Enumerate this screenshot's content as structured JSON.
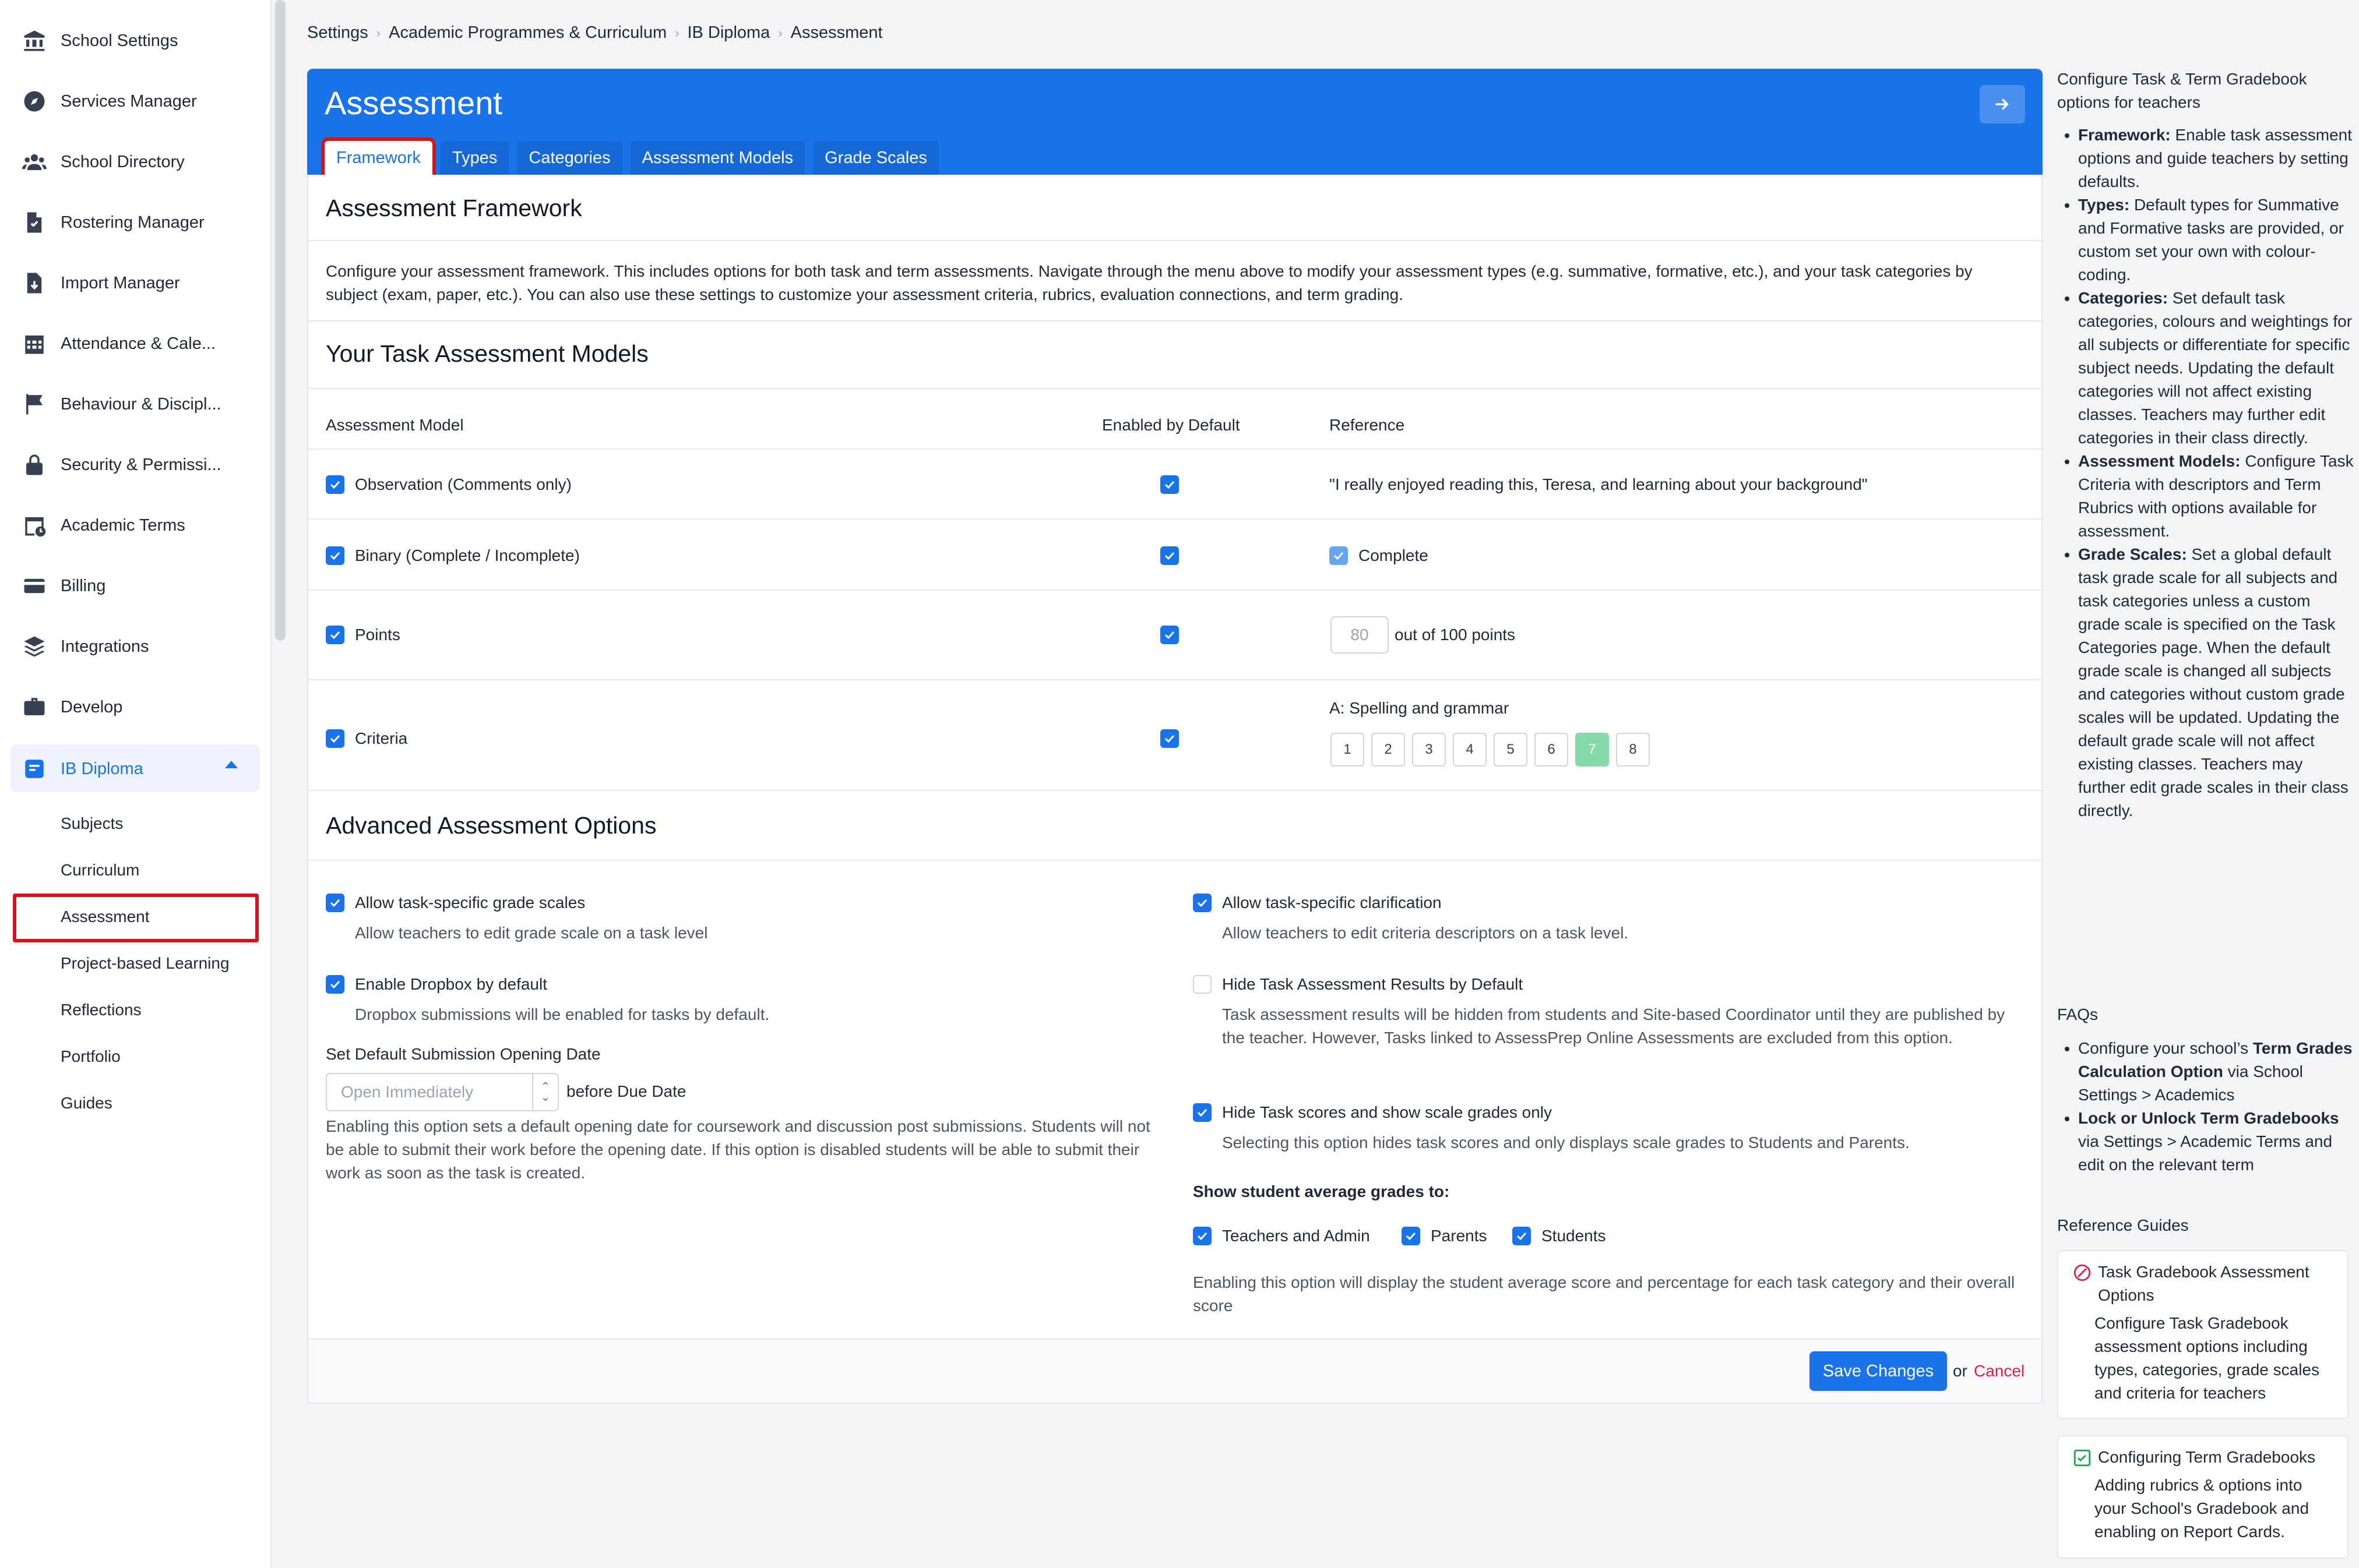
{
  "sidebar": {
    "items": [
      {
        "label": "School Settings",
        "icon": "bank-icon"
      },
      {
        "label": "Services Manager",
        "icon": "compass-icon"
      },
      {
        "label": "School Directory",
        "icon": "people-icon"
      },
      {
        "label": "Rostering Manager",
        "icon": "file-icon"
      },
      {
        "label": "Import Manager",
        "icon": "file-import-icon"
      },
      {
        "label": "Attendance & Cale...",
        "icon": "calendar-icon"
      },
      {
        "label": "Behaviour & Discipl...",
        "icon": "flag-icon"
      },
      {
        "label": "Security & Permissi...",
        "icon": "lock-icon"
      },
      {
        "label": "Academic Terms",
        "icon": "calendar-clock-icon"
      },
      {
        "label": "Billing",
        "icon": "card-icon"
      },
      {
        "label": "Integrations",
        "icon": "layers-icon"
      },
      {
        "label": "Develop",
        "icon": "briefcase-icon"
      },
      {
        "label": "IB Diploma",
        "icon": "ib-icon"
      }
    ],
    "subitems": [
      "Subjects",
      "Curriculum",
      "Assessment",
      "Project-based Learning",
      "Reflections",
      "Portfolio",
      "Guides"
    ]
  },
  "breadcrumb": [
    "Settings",
    "Academic Programmes & Curriculum",
    "IB Diploma",
    "Assessment"
  ],
  "header": {
    "title": "Assessment",
    "tabs": [
      "Framework",
      "Types",
      "Categories",
      "Assessment Models",
      "Grade Scales"
    ]
  },
  "framework": {
    "title": "Assessment Framework",
    "description": "Configure your assessment framework. This includes options for both task and term assessments. Navigate through the menu above to modify your assessment types (e.g. summative, formative, etc.), and your task categories by subject (exam, paper, etc.). You can also use these settings to customize your assessment criteria, rubrics, evaluation connections, and term grading."
  },
  "models": {
    "title": "Your Task Assessment Models",
    "col_model": "Assessment Model",
    "col_enabled": "Enabled by Default",
    "col_reference": "Reference",
    "rows": [
      {
        "name": "Observation (Comments only)",
        "reference": "\"I really enjoyed reading this, Teresa, and learning about your background\""
      },
      {
        "name": "Binary (Complete / Incomplete)",
        "reference": "Complete"
      },
      {
        "name": "Points",
        "points_value": "80",
        "reference": "out of 100 points"
      },
      {
        "name": "Criteria",
        "reference": "A: Spelling and grammar",
        "grades": [
          "1",
          "2",
          "3",
          "4",
          "5",
          "6",
          "7",
          "8"
        ],
        "selected_grade": "7"
      }
    ]
  },
  "advanced": {
    "title": "Advanced Assessment Options",
    "grade_scales": {
      "label": "Allow task-specific grade scales",
      "desc": "Allow teachers to edit grade scale on a task level"
    },
    "dropbox": {
      "label": "Enable Dropbox by default",
      "desc": "Dropbox submissions will be enabled for tasks by default."
    },
    "submission": {
      "label": "Set Default Submission Opening Date",
      "placeholder": "Open Immediately",
      "suffix": "before Due Date",
      "desc": "Enabling this option sets a default opening date for coursework and discussion post submissions. Students will not be able to submit their work before the opening date. If this option is disabled students will be able to submit their work as soon as the task is created."
    },
    "clarification": {
      "label": "Allow task-specific clarification",
      "desc": "Allow teachers to edit criteria descriptors on a task level."
    },
    "hide_results": {
      "label": "Hide Task Assessment Results by Default",
      "desc": "Task assessment results will be hidden from students and Site-based Coordinator until they are published by the teacher. However, Tasks linked to AssessPrep Online Assessments are excluded from this option."
    },
    "hide_scores": {
      "label": "Hide Task scores and show scale grades only",
      "desc": "Selecting this option hides task scores and only displays scale grades to Students and Parents."
    },
    "average": {
      "label": "Show student average grades to:",
      "options": [
        "Teachers and Admin",
        "Parents",
        "Students"
      ],
      "desc": "Enabling this option will display the student average score and percentage for each task category and their overall score"
    }
  },
  "footer": {
    "save": "Save Changes",
    "or": "or",
    "cancel": "Cancel"
  },
  "help": {
    "intro": "Configure Task & Term Gradebook options for teachers",
    "bullets": [
      {
        "bold": "Framework:",
        "text": " Enable task assessment options and guide teachers by setting defaults."
      },
      {
        "bold": "Types:",
        "text": " Default types for Summative and Formative tasks are provided, or custom set your own with colour-coding."
      },
      {
        "bold": "Categories:",
        "text": " Set default task categories, colours and weightings for all subjects or differentiate for specific subject needs. Updating the default categories will not affect existing classes. Teachers may further edit categories in their class directly."
      },
      {
        "bold": "Assessment Models:",
        "text": " Configure Task Criteria with descriptors and Term Rubrics with options available for assessment."
      },
      {
        "bold": "Grade Scales:",
        "text": " Set a global default task grade scale for all subjects and task categories unless a custom grade scale is specified on the Task Categories page. When the default grade scale is changed all subjects and categories without custom grade scales will be updated. Updating the default grade scale will not affect existing classes. Teachers may further edit grade scales in their class directly."
      }
    ],
    "faqs_title": "FAQs",
    "faqs": [
      {
        "pre": "Configure your school’s ",
        "bold": "Term Grades Calculation Option",
        "post": " via School Settings > Academics"
      },
      {
        "pre": "",
        "bold": "Lock or Unlock Term Gradebooks",
        "post": " via Settings > Academic Terms and edit on the relevant term"
      }
    ],
    "guides_title": "Reference Guides",
    "guides": [
      {
        "title": "Task Gradebook Assessment Options",
        "desc": "Configure Task Gradebook assessment options including types, categories, grade scales and criteria for teachers"
      },
      {
        "title": "Configuring Term Gradebooks",
        "desc": "Adding rubrics & options into your School's Gradebook and enabling on Report Cards."
      }
    ]
  },
  "colors": {
    "primary": "#1a73e8",
    "highlight": "#d4141c",
    "grade_selected": "#86d9a8",
    "cancel": "#e11d48"
  }
}
